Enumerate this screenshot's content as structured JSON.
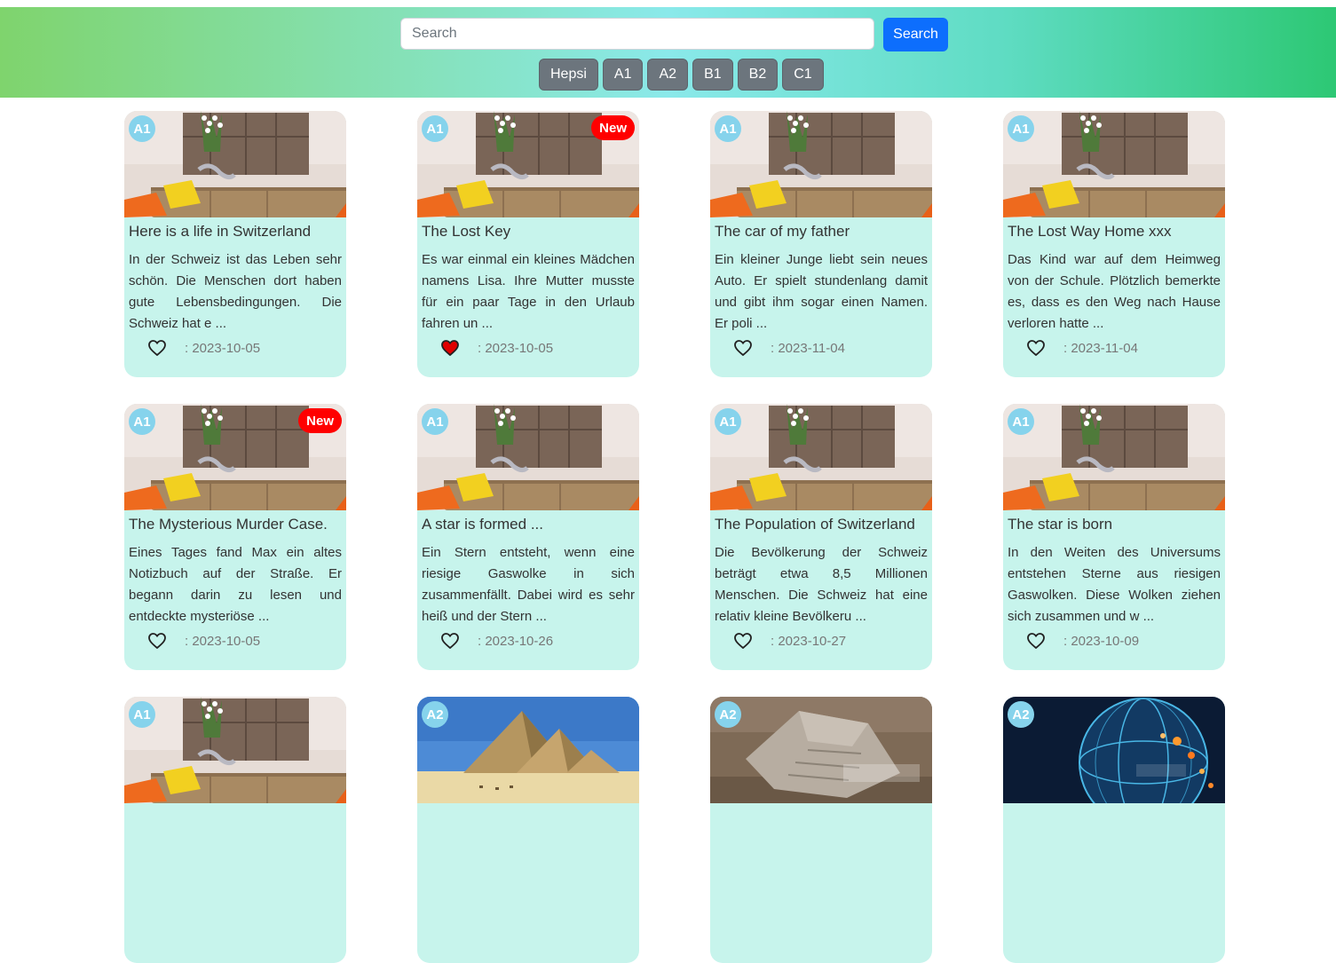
{
  "search": {
    "placeholder": "Search",
    "value": "",
    "button_label": "Search"
  },
  "filters": [
    "Hepsi",
    "A1",
    "A2",
    "B1",
    "B2",
    "C1"
  ],
  "colors": {
    "card_bg": "#c7f4ec",
    "level_badge": "#86d3ec",
    "new_badge": "#ff0000",
    "search_button": "#0d6efd",
    "filter_button": "#6c757d",
    "liked_heart": "#e00000"
  },
  "cards": [
    {
      "level": "A1",
      "is_new": false,
      "new_label": "",
      "image": "living-room-photo",
      "title": "Here is a life in Switzerland",
      "excerpt": "In der Schweiz ist das Leben sehr schön. Die Menschen dort haben gute Lebensbedingungen. Die Schweiz hat e ...",
      "liked": false,
      "date": ": 2023-10-05"
    },
    {
      "level": "A1",
      "is_new": true,
      "new_label": "New",
      "image": "living-room-photo",
      "title": "The Lost Key",
      "excerpt": "Es war einmal ein kleines Mädchen namens Lisa. Ihre Mutter musste für ein paar Tage in den Urlaub fahren un ...",
      "liked": true,
      "date": ": 2023-10-05"
    },
    {
      "level": "A1",
      "is_new": false,
      "new_label": "",
      "image": "living-room-photo",
      "title": "The car of my father",
      "excerpt": "Ein kleiner Junge liebt sein neues Auto. Er spielt stundenlang damit und gibt ihm sogar einen Namen. Er poli ...",
      "liked": false,
      "date": ": 2023-11-04"
    },
    {
      "level": "A1",
      "is_new": false,
      "new_label": "",
      "image": "living-room-photo",
      "title": "The Lost Way Home xxx",
      "excerpt": "Das Kind war auf dem Heimweg von der Schule. Plötzlich bemerkte es, dass es den Weg nach Hause verloren hatte ...",
      "liked": false,
      "date": ": 2023-11-04"
    },
    {
      "level": "A1",
      "is_new": true,
      "new_label": "New",
      "image": "living-room-photo",
      "title": "The Mysterious Murder Case.",
      "excerpt": "Eines Tages fand Max ein altes Notizbuch auf der Straße. Er begann darin zu lesen und entdeckte mysteriöse ...",
      "liked": false,
      "date": ": 2023-10-05"
    },
    {
      "level": "A1",
      "is_new": false,
      "new_label": "",
      "image": "living-room-photo",
      "title": "A star is formed ...",
      "excerpt": "Ein Stern entsteht, wenn eine riesige Gaswolke in sich zusammenfällt. Dabei wird es sehr heiß und der Stern ...",
      "liked": false,
      "date": ": 2023-10-26"
    },
    {
      "level": "A1",
      "is_new": false,
      "new_label": "",
      "image": "living-room-photo",
      "title": "The Population of Switzerland",
      "excerpt": "Die Bevölkerung der Schweiz beträgt etwa 8,5 Millionen Menschen. Die Schweiz hat eine relativ kleine Bevölkeru ...",
      "liked": false,
      "date": ": 2023-10-27"
    },
    {
      "level": "A1",
      "is_new": false,
      "new_label": "",
      "image": "living-room-photo",
      "title": "The star is born",
      "excerpt": "In den Weiten des Universums entstehen Sterne aus riesigen Gaswolken. Diese Wolken ziehen sich zusammen und w ...",
      "liked": false,
      "date": ": 2023-10-09"
    },
    {
      "level": "A1",
      "is_new": false,
      "new_label": "",
      "image": "living-room-photo",
      "title": "",
      "excerpt": "",
      "liked": false,
      "date": ""
    },
    {
      "level": "A2",
      "is_new": false,
      "new_label": "",
      "image": "pyramids-photo",
      "title": "",
      "excerpt": "",
      "liked": false,
      "date": ""
    },
    {
      "level": "A2",
      "is_new": false,
      "new_label": "",
      "image": "stone-tablet-photo",
      "title": "",
      "excerpt": "",
      "liked": false,
      "date": ""
    },
    {
      "level": "A2",
      "is_new": false,
      "new_label": "",
      "image": "digital-globe-photo",
      "title": "",
      "excerpt": "",
      "liked": false,
      "date": ""
    }
  ]
}
